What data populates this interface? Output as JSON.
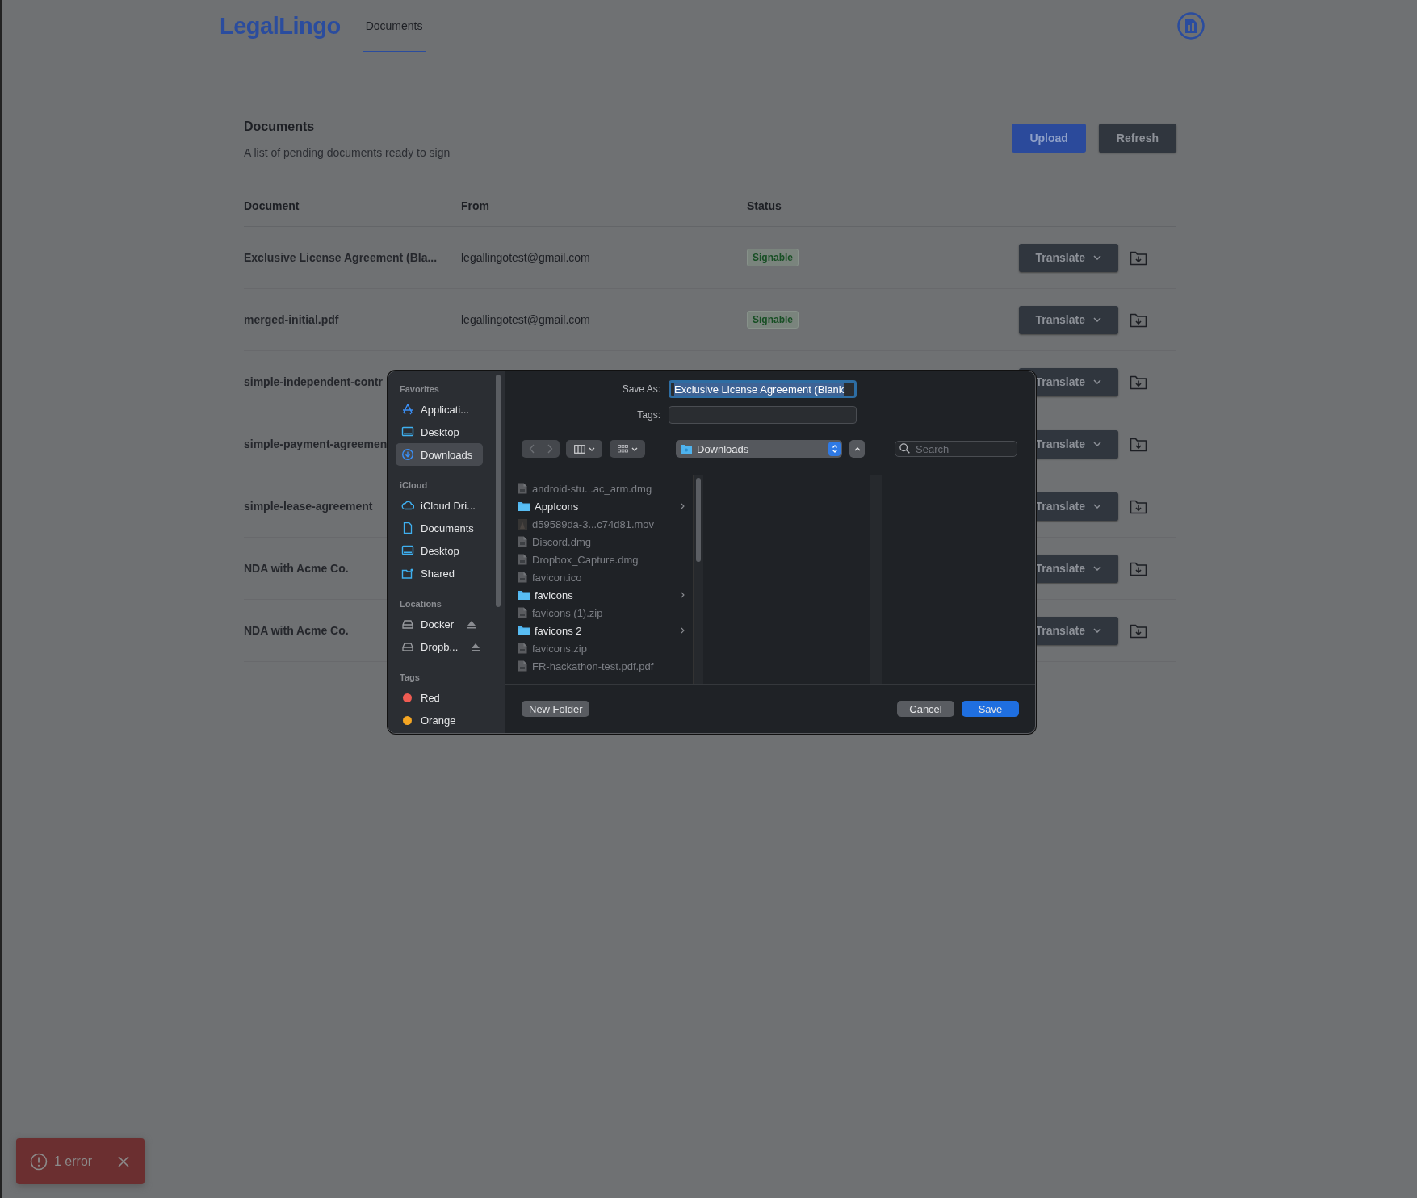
{
  "app": {
    "logo": "LegalLingo",
    "nav": [
      {
        "label": "Documents",
        "selected": true
      }
    ]
  },
  "page": {
    "title": "Documents",
    "subtitle": "A list of pending documents ready to sign",
    "actions": [
      {
        "label": "Upload",
        "kind": "primary"
      },
      {
        "label": "Refresh",
        "kind": "secondary"
      }
    ]
  },
  "table": {
    "columns": [
      "Document",
      "From",
      "Status"
    ],
    "rows": [
      {
        "document": "Exclusive License Agreement (Bla...",
        "from": "legallingotest@gmail.com",
        "status": "Signable",
        "action": "Translate"
      },
      {
        "document": "merged-initial.pdf",
        "from": "legallingotest@gmail.com",
        "status": "Signable",
        "action": "Translate"
      },
      {
        "document": "simple-independent-contr",
        "action": "Translate"
      },
      {
        "document": "simple-payment-agreemen",
        "action": "Translate"
      },
      {
        "document": "simple-lease-agreement",
        "action": "Translate"
      },
      {
        "document": "NDA with Acme Co.",
        "action": "Translate"
      },
      {
        "document": "NDA with Acme Co.",
        "action": "Translate"
      }
    ]
  },
  "dialog": {
    "save_as_label": "Save As:",
    "save_as_value": "Exclusive License Agreement (Blank",
    "tags_label": "Tags:",
    "sidebar": [
      {
        "heading": "Favorites",
        "items": [
          {
            "label": "Applicati...",
            "kind": "apps",
            "selected": false
          },
          {
            "label": "Desktop",
            "kind": "desktop",
            "selected": false
          },
          {
            "label": "Downloads",
            "kind": "downloads",
            "selected": true
          }
        ]
      },
      {
        "heading": "iCloud",
        "items": [
          {
            "label": "iCloud Dri...",
            "kind": "cloud",
            "selected": false
          },
          {
            "label": "Documents",
            "kind": "document",
            "selected": false
          },
          {
            "label": "Desktop",
            "kind": "desktop",
            "selected": false
          },
          {
            "label": "Shared",
            "kind": "shared",
            "selected": false
          }
        ]
      },
      {
        "heading": "Locations",
        "items": [
          {
            "label": "Docker",
            "kind": "drive",
            "selected": false
          },
          {
            "label": "Dropb...",
            "kind": "drive",
            "selected": false
          }
        ]
      },
      {
        "heading": "Tags",
        "items": [
          {
            "label": "Red",
            "kind": "tag",
            "color": "#ef5b52",
            "selected": false
          },
          {
            "label": "Orange",
            "kind": "tag",
            "color": "#f5a623",
            "selected": false
          }
        ]
      }
    ],
    "location": "Downloads",
    "search": {
      "placeholder": "Search"
    },
    "files": [
      {
        "name": "android-stu...ac_arm.dmg",
        "kind": "file",
        "disabled": true
      },
      {
        "name": "AppIcons",
        "kind": "folder",
        "disabled": false
      },
      {
        "name": "d59589da-3...c74d81.mov",
        "kind": "movie",
        "disabled": true
      },
      {
        "name": "Discord.dmg",
        "kind": "file",
        "disabled": true
      },
      {
        "name": "Dropbox_Capture.dmg",
        "kind": "file",
        "disabled": true
      },
      {
        "name": "favicon.ico",
        "kind": "file",
        "disabled": true
      },
      {
        "name": "favicons",
        "kind": "folder",
        "disabled": false
      },
      {
        "name": "favicons (1).zip",
        "kind": "file",
        "disabled": true
      },
      {
        "name": "favicons 2",
        "kind": "folder",
        "disabled": false
      },
      {
        "name": "favicons.zip",
        "kind": "file",
        "disabled": true
      },
      {
        "name": "FR-hackathon-test.pdf.pdf",
        "kind": "file",
        "disabled": true
      }
    ],
    "buttons": [
      {
        "label": "New Folder",
        "kind": "secondary"
      },
      {
        "label": "Cancel",
        "kind": "secondary"
      },
      {
        "label": "Save",
        "kind": "primary"
      }
    ]
  },
  "toast": {
    "text": "1 error"
  }
}
